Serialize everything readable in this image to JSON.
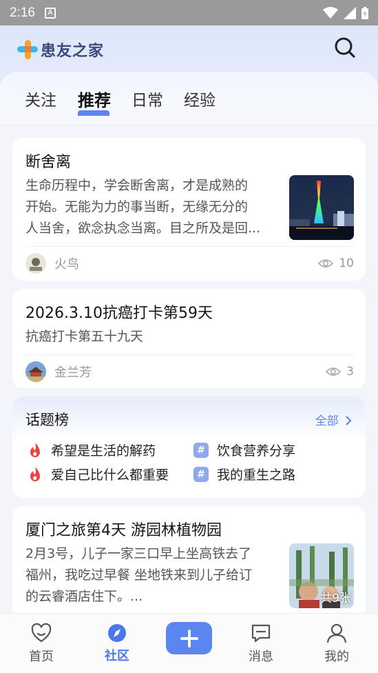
{
  "status_bar": {
    "time": "2:16",
    "notification_letter": "A"
  },
  "app": {
    "logo_text": "患友之家"
  },
  "tabs": [
    {
      "label": "关注",
      "active": false
    },
    {
      "label": "推荐",
      "active": true
    },
    {
      "label": "日常",
      "active": false
    },
    {
      "label": "经验",
      "active": false
    }
  ],
  "posts": [
    {
      "title": "断舍离",
      "body": [
        "生命历程中，学会断舍离，才是成熟的",
        "开始。无能为力的事当断，无缘无分的",
        "人当舍，欲念执念当离。目之所及是回..."
      ],
      "author": "火鸟",
      "views": "10"
    },
    {
      "title": "2026.3.10抗癌打卡第59天",
      "body": [
        "抗癌打卡第五十九天"
      ],
      "author": "金兰芳",
      "views": "3"
    },
    {
      "title": "厦门之旅第4天 游园林植物园",
      "body": [
        "2月3号，儿子一家三口早上坐高铁去了",
        "福州，我吃过早餐 坐地铁来到儿子给订",
        "的云睿酒店住下。..."
      ],
      "image_count_label": "共9张"
    }
  ],
  "topics": {
    "title": "话题榜",
    "all_label": "全部",
    "items": [
      {
        "label": "希望是生活的解药",
        "icon": "flame-icon"
      },
      {
        "label": "饮食营养分享",
        "icon": "hash-icon"
      },
      {
        "label": "爱自己比什么都重要",
        "icon": "flame-icon"
      },
      {
        "label": "我的重生之路",
        "icon": "hash-icon"
      }
    ]
  },
  "bottom_nav": [
    {
      "label": "首页",
      "icon": "heart-home-icon",
      "active": false
    },
    {
      "label": "社区",
      "icon": "compass-icon",
      "active": true
    },
    {
      "label": "消息",
      "icon": "message-icon",
      "active": false
    },
    {
      "label": "我的",
      "icon": "profile-icon",
      "active": false
    }
  ],
  "colors": {
    "accent": "#5b86f0",
    "flame": "#e8453c",
    "hash": "#8fa9ec"
  }
}
